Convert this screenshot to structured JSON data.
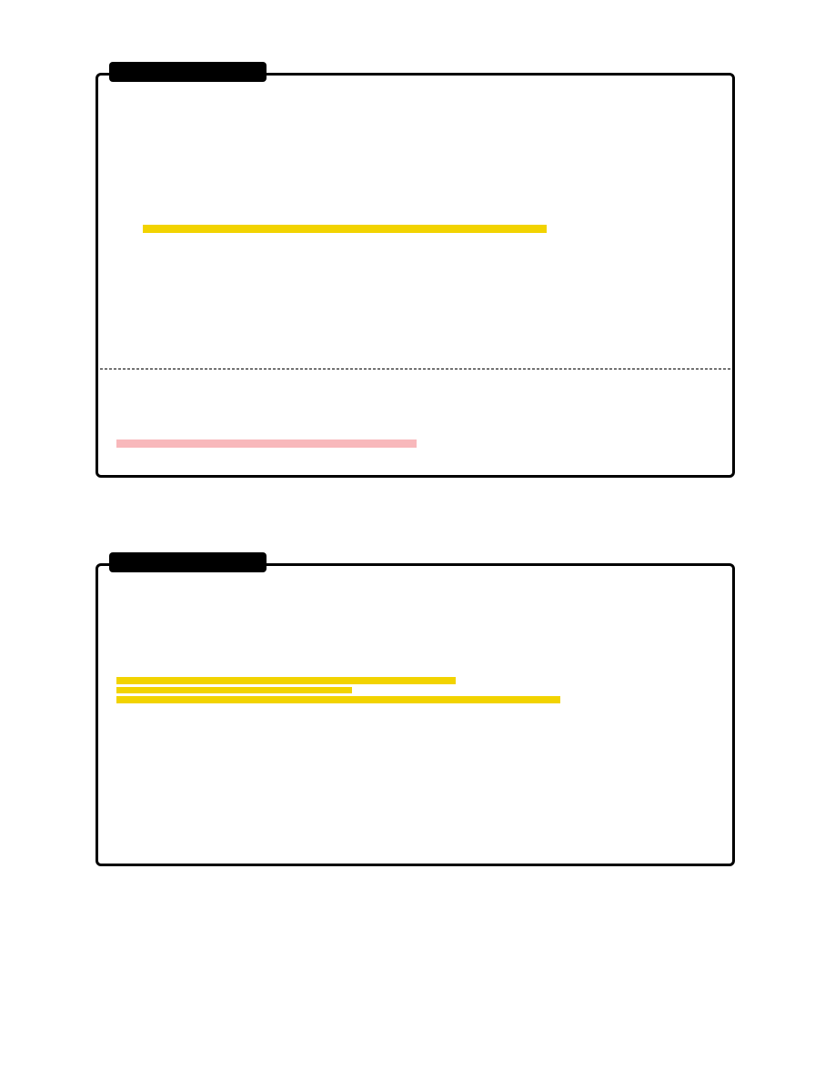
{
  "panels": [
    {
      "tab_label": "",
      "highlights": [
        {
          "color": "#f2d300",
          "text": ""
        },
        {
          "color": "#f8b8bb",
          "text": ""
        }
      ],
      "has_dashed_divider": true
    },
    {
      "tab_label": "",
      "highlights": [
        {
          "color": "#f2d300",
          "text": ""
        },
        {
          "color": "#f2d300",
          "text": ""
        },
        {
          "color": "#f2d300",
          "text": ""
        }
      ],
      "has_dashed_divider": false
    }
  ],
  "colors": {
    "highlight_yellow": "#f2d300",
    "highlight_pink": "#f8b8bb",
    "border": "#000000",
    "background": "#ffffff"
  }
}
